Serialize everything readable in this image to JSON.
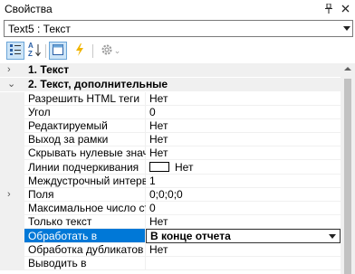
{
  "window": {
    "title": "Свойства",
    "pin_glyph": "ᵖ",
    "close_glyph": "×"
  },
  "selector": {
    "value": "Text5 : Текст"
  },
  "toolbar": {
    "alpha_top": "A",
    "alpha_bottom": "Z",
    "settings_caret": "⌄"
  },
  "grid": {
    "cat1": {
      "label": "1. Текст",
      "chevron": "›"
    },
    "cat2": {
      "label": "2. Текст, дополнительные",
      "chevron": "⌄"
    },
    "props": [
      {
        "name": "Разрешить HTML теги",
        "value": "Нет"
      },
      {
        "name": "Угол",
        "value": "0"
      },
      {
        "name": "Редактируемый",
        "value": "Нет"
      },
      {
        "name": "Выход за рамки",
        "value": "Нет"
      },
      {
        "name": "Скрывать нулевые значения",
        "value": "Нет"
      },
      {
        "name": "Линии подчеркивания",
        "value": "Нет"
      },
      {
        "name": "Междустрочный интервал",
        "value": "1"
      },
      {
        "name": "Поля",
        "value": "0;0;0;0",
        "chevron": "›"
      },
      {
        "name": "Максимальное число строк",
        "value": "0"
      },
      {
        "name": "Только текст",
        "value": "Нет"
      },
      {
        "name": "Обработать в",
        "value": "В конце отчета"
      },
      {
        "name": "Обработка дубликатов",
        "value": "Нет"
      },
      {
        "name": "Выводить в",
        "value": ""
      }
    ]
  },
  "colors": {
    "selection": "#0078d7",
    "gutter": "#f0f0f0",
    "accent_active": "#cce4f7"
  }
}
